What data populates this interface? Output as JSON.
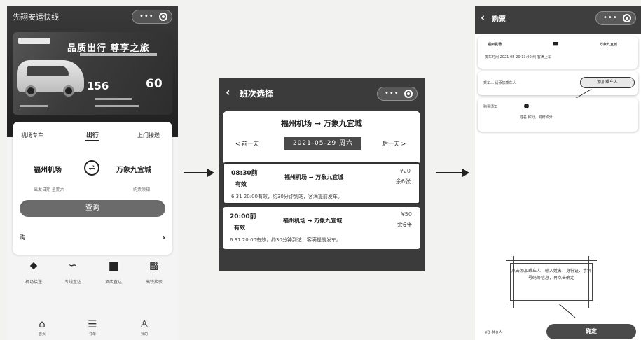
{
  "screen1": {
    "title": "先翔安运快线",
    "banner": {
      "slogan": "品质出行 尊享之旅",
      "price_a": "156",
      "price_b": "60"
    },
    "tabs": [
      "机场专车",
      "出行",
      "上门接送"
    ],
    "from": "福州机场",
    "to": "万象九宜城",
    "hint_left": "出发日期 星期六",
    "hint_right": "购票须知",
    "query_button": "查询",
    "row_label": "购",
    "services": [
      {
        "icon": "location-pin-icon",
        "glyph": "⬥",
        "label": "机场接送"
      },
      {
        "icon": "route-icon",
        "glyph": "∽",
        "label": "专线直达"
      },
      {
        "icon": "bus-icon",
        "glyph": "▆",
        "label": "酒店直达"
      },
      {
        "icon": "train-icon",
        "glyph": "▩",
        "label": "高铁接驳"
      }
    ],
    "nav": [
      {
        "icon": "home-icon",
        "glyph": "⌂",
        "label": "首页"
      },
      {
        "icon": "orders-icon",
        "glyph": "☰",
        "label": "订单"
      },
      {
        "icon": "user-icon",
        "glyph": "♙",
        "label": "我的"
      }
    ]
  },
  "screen2": {
    "title": "班次选择",
    "route": "福州机场 → 万象九宜城",
    "prev_day": "< 前一天",
    "date": "2021-05-29 周六",
    "next_day": "后一天 >",
    "trips": [
      {
        "time": "08:30前",
        "status": "有效",
        "route": "福州机场 → 万象九宜城",
        "price": "¥20",
        "seats": "余6张",
        "note": "6.31 20:00有效，约30分钟到站，客满提前发车。"
      },
      {
        "time": "20:00前",
        "status": "有效",
        "route": "福州机场 → 万象九宜城",
        "price": "¥50",
        "seats": "余6张",
        "note": "6.31 20:00有效，约30分钟到达，客满提前发车。"
      }
    ]
  },
  "screen3": {
    "title": "购票",
    "from": "福州机场",
    "to": "万象九宜城",
    "depart_line": "发车时间 2021-05-29 13:00  约 客满上车",
    "passenger_label": "乘车人 请添加乘车人",
    "add_button": "添加乘车人",
    "notice_label": "购票须知",
    "notice_sub": "姓名 积分，附赠积分",
    "help_text": "点击添加乘车人，输入姓名、身份证、手机号码等信息，再点击确定",
    "total": "¥0  共0人",
    "confirm_button": "确定"
  }
}
